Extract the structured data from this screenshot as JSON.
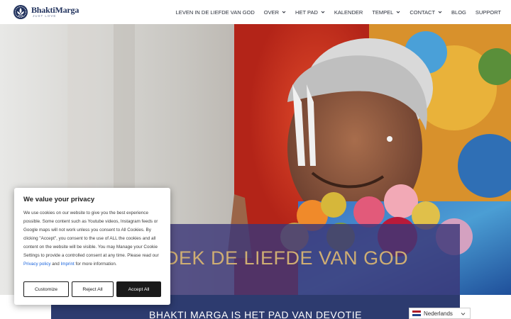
{
  "brand": {
    "title": "BhaktiMarga",
    "tagline": "JUST LOVE"
  },
  "nav": {
    "items": [
      {
        "label": "LEVEN IN DE LIEFDE VAN GOD",
        "dropdown": false
      },
      {
        "label": "OVER",
        "dropdown": true
      },
      {
        "label": "HET PAD",
        "dropdown": true
      },
      {
        "label": "KALENDER",
        "dropdown": false
      },
      {
        "label": "TEMPEL",
        "dropdown": true
      },
      {
        "label": "CONTACT",
        "dropdown": true
      },
      {
        "label": "BLOG",
        "dropdown": false
      },
      {
        "label": "SUPPORT",
        "dropdown": false
      }
    ]
  },
  "hero": {
    "headline": "DEK DE LIEFDE VAN GOD",
    "subheadline": "BHAKTI MARGA IS HET PAD VAN DEVOTIE"
  },
  "cookie": {
    "title": "We value your privacy",
    "body_1": "We use cookies on our website to give you the best experience possible. Some content such as Youtube videos, Instagram feeds or Google maps will not work unless you consent to All Cookies. By clicking \"Accept\", you consent to the use of ALL the cookies and all content on the website will be visible. You may Manage your Cookie Settings to provide a controlled consent at any time. Please read our ",
    "privacy_link": "Privacy policy",
    "and": " and ",
    "imprint_link": "Imprint",
    "body_2": " for more information.",
    "customize_label": "Customize",
    "reject_label": "Reject All",
    "accept_label": "Accept All"
  },
  "language": {
    "label": "Nederlands",
    "flag": "nl-flag-icon"
  },
  "colors": {
    "brand_navy": "#22335e",
    "hero_band": "#3c3778",
    "headline_gold": "#cfae73",
    "link_blue": "#1863dc"
  }
}
